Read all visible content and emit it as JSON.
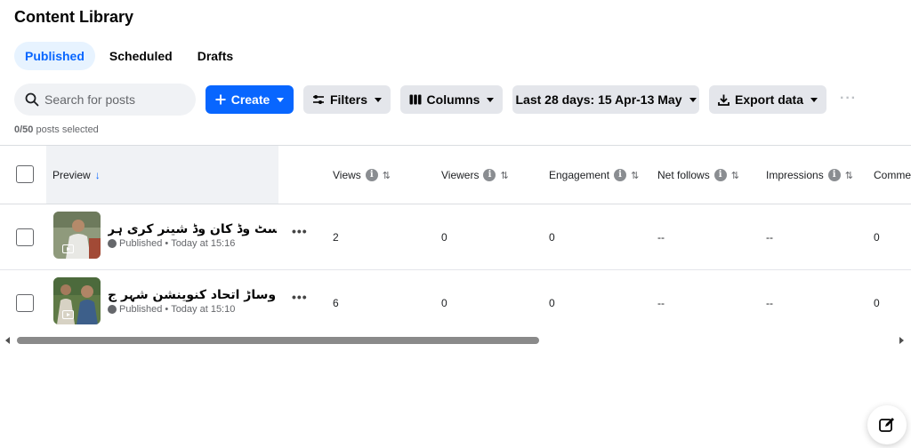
{
  "page_title": "Content Library",
  "tabs": [
    {
      "label": "Published",
      "active": true
    },
    {
      "label": "Scheduled",
      "active": false
    },
    {
      "label": "Drafts",
      "active": false
    }
  ],
  "search": {
    "placeholder": "Search for posts",
    "value": ""
  },
  "toolbar": {
    "create_label": "Create",
    "filters_label": "Filters",
    "columns_label": "Columns",
    "date_range_label": "Last 28 days: 15 Apr-13 May",
    "export_label": "Export data",
    "more_label": "···"
  },
  "selection": {
    "count_text": "0/50",
    "suffix": "posts selected"
  },
  "table": {
    "headers": {
      "preview": "Preview",
      "views": "Views",
      "viewers": "Viewers",
      "engagement": "Engagement",
      "net_follows": "Net follows",
      "impressions": "Impressions",
      "comments": "Comme"
    },
    "rows": [
      {
        "title": "یوسٹ وڈ کان وڈ شینر کری ہر...",
        "status": "Published",
        "time": "Today at 15:16",
        "views": "2",
        "viewers": "0",
        "engagement": "0",
        "net_follows": "--",
        "impressions": "--",
        "comments": "0"
      },
      {
        "title": "آل وساڑ اتحاد کنوینشن شہر ج...",
        "status": "Published",
        "time": "Today at 15:10",
        "views": "6",
        "viewers": "0",
        "engagement": "0",
        "net_follows": "--",
        "impressions": "--",
        "comments": "0"
      }
    ]
  },
  "icons": {
    "search": "search-icon",
    "plus": "plus-icon",
    "filters": "sliders-icon",
    "columns": "columns-icon",
    "export": "download-icon",
    "info": "info-icon",
    "sort": "sort-icon",
    "compose": "compose-icon"
  },
  "colors": {
    "accent": "#0866ff",
    "tab_active_bg": "#e7f3ff",
    "button_bg": "#e4e6eb"
  }
}
